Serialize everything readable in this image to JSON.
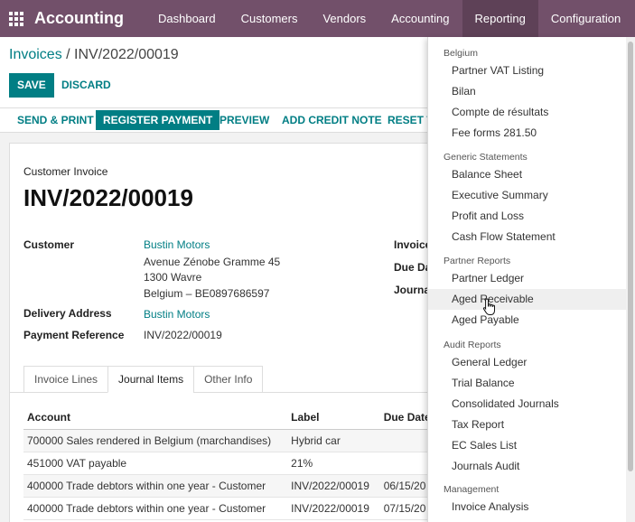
{
  "navbar": {
    "brand": "Accounting",
    "items": [
      "Dashboard",
      "Customers",
      "Vendors",
      "Accounting",
      "Reporting",
      "Configuration"
    ],
    "active": "Reporting"
  },
  "breadcrumb": {
    "parent": "Invoices",
    "separator": " / ",
    "current": "INV/2022/00019"
  },
  "buttons": {
    "save": "SAVE",
    "discard": "DISCARD"
  },
  "actions": {
    "send_print": "SEND & PRINT",
    "register_payment": "REGISTER PAYMENT",
    "preview": "PREVIEW",
    "add_credit_note": "ADD CREDIT NOTE",
    "reset": "RESET T"
  },
  "form": {
    "doc_type": "Customer Invoice",
    "title": "INV/2022/00019",
    "customer_label": "Customer",
    "customer_name": "Bustin Motors",
    "address_line1": "Avenue Zénobe Gramme 45",
    "address_line2": "1300 Wavre",
    "address_line3": "Belgium – BE0897686597",
    "delivery_label": "Delivery Address",
    "delivery_value": "Bustin Motors",
    "payref_label": "Payment Reference",
    "payref_value": "INV/2022/00019",
    "right_label1": "Invoice",
    "right_label2": "Due Da",
    "right_label3": "Journa"
  },
  "tabs": [
    "Invoice Lines",
    "Journal Items",
    "Other Info"
  ],
  "active_tab": "Journal Items",
  "table": {
    "headers": [
      "Account",
      "Label",
      "Due Date"
    ],
    "rows": [
      [
        "700000 Sales rendered in Belgium (marchandises)",
        "Hybrid car",
        ""
      ],
      [
        "451000 VAT payable",
        "21%",
        ""
      ],
      [
        "400000 Trade debtors within one year - Customer",
        "INV/2022/00019",
        "06/15/20"
      ],
      [
        "400000 Trade debtors within one year - Customer",
        "INV/2022/00019",
        "07/15/20"
      ]
    ]
  },
  "menu": {
    "sections": [
      {
        "header": "Belgium",
        "items": [
          "Partner VAT Listing",
          "Bilan",
          "Compte de résultats",
          "Fee forms 281.50"
        ]
      },
      {
        "header": "Generic Statements",
        "items": [
          "Balance Sheet",
          "Executive Summary",
          "Profit and Loss",
          "Cash Flow Statement"
        ]
      },
      {
        "header": "Partner Reports",
        "items": [
          "Partner Ledger",
          "Aged Receivable",
          "Aged Payable"
        ]
      },
      {
        "header": "Audit Reports",
        "items": [
          "General Ledger",
          "Trial Balance",
          "Consolidated Journals",
          "Tax Report",
          "EC Sales List",
          "Journals Audit"
        ]
      },
      {
        "header": "Management",
        "items": [
          "Invoice Analysis"
        ]
      }
    ],
    "hovered": "Aged Receivable"
  },
  "colors": {
    "navbar": "#72506a",
    "accent": "#017e84"
  }
}
